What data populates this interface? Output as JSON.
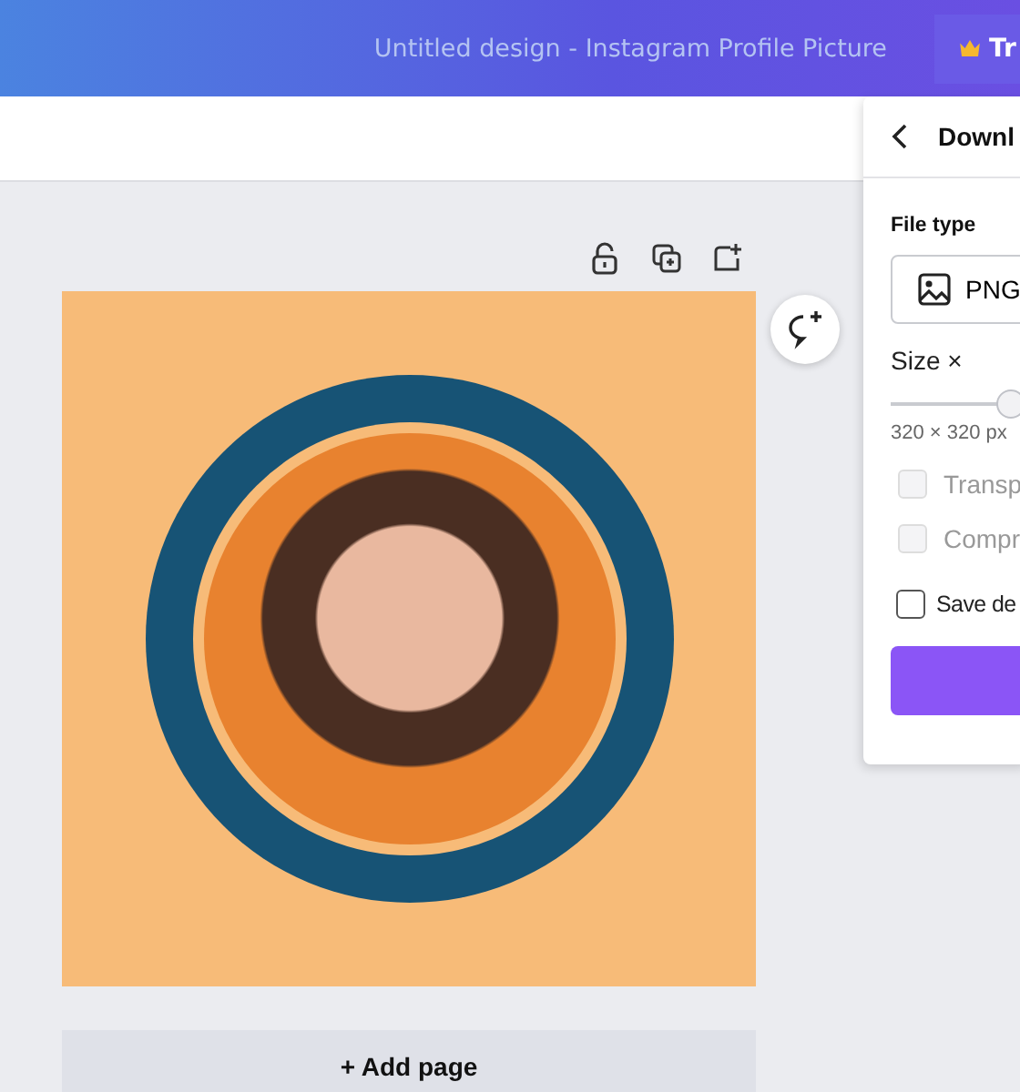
{
  "header": {
    "title": "Untitled design - Instagram Profile Picture",
    "upgrade_button": "Tr"
  },
  "download_panel": {
    "title": "Downl",
    "file_type_label": "File type",
    "file_type": "PNG",
    "size_label": "Size ×",
    "size_slider": {
      "level": 0.3
    },
    "size_reading": "320 × 320 px",
    "options": [
      {
        "label": "Transp",
        "checked": false,
        "disabled": true
      },
      {
        "label": "Compr",
        "checked": false,
        "disabled": true
      },
      {
        "label": "Save de",
        "checked": false,
        "disabled": false
      }
    ]
  },
  "add_page_button": "+ Add page"
}
